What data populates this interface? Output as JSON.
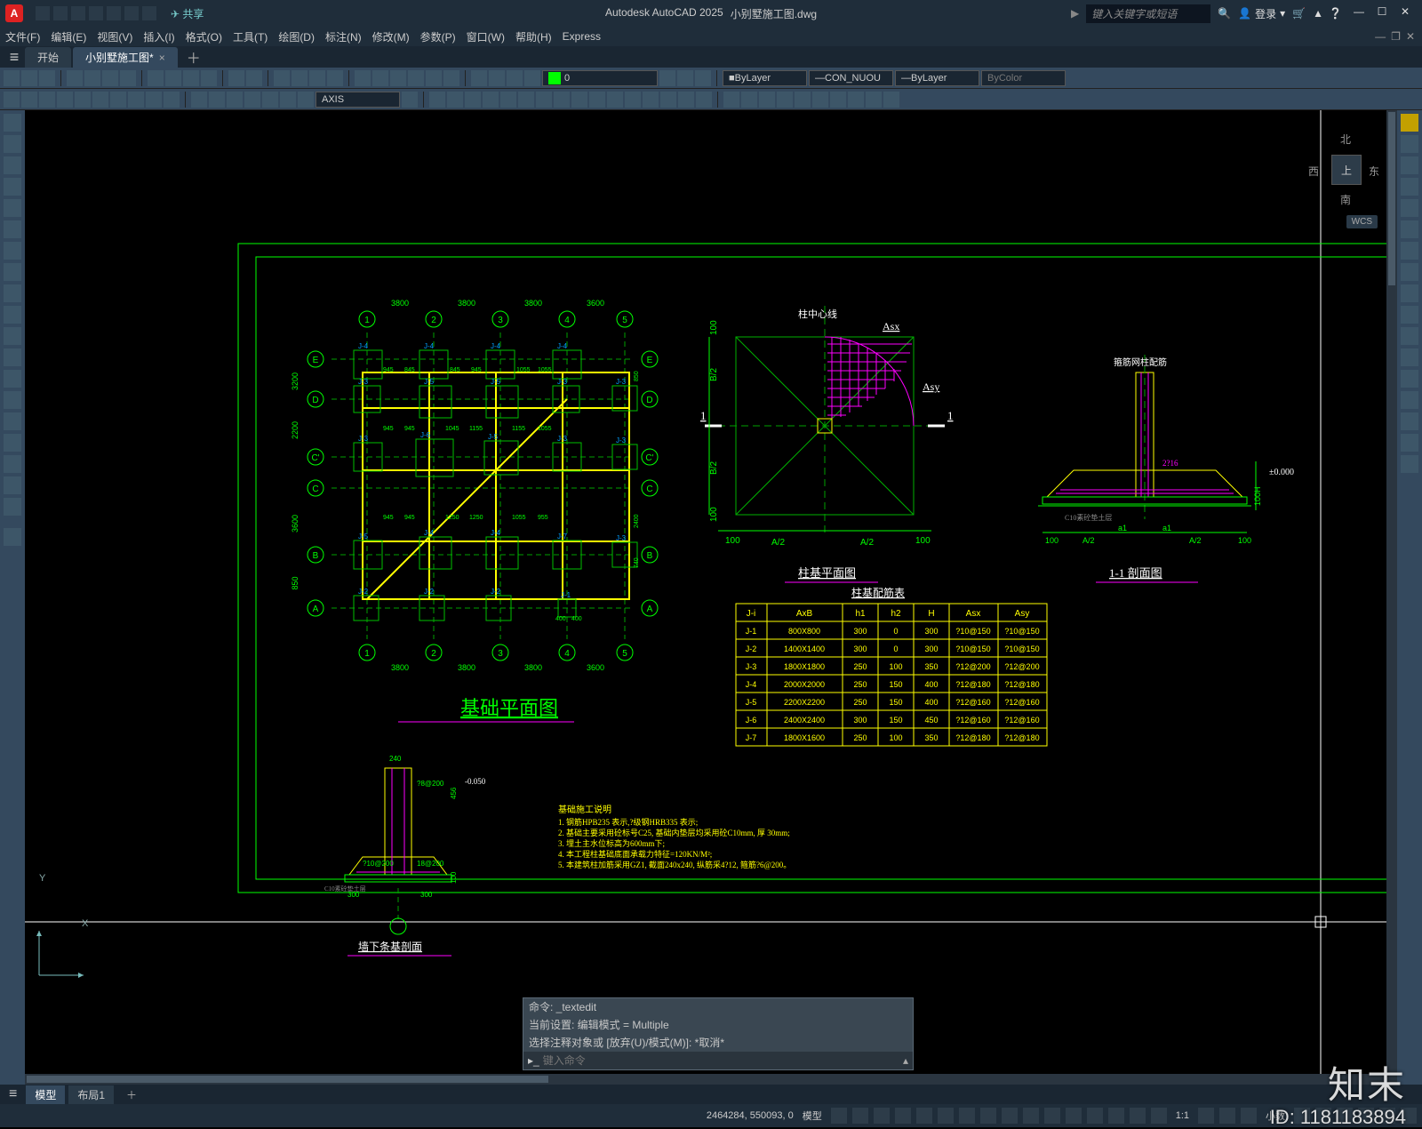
{
  "app": {
    "name": "Autodesk AutoCAD 2025",
    "doc": "小别墅施工图.dwg",
    "icon": "A"
  },
  "qat": {
    "share": "共享"
  },
  "search_placeholder": "键入关键字或短语",
  "login_label": "登录",
  "menu": [
    "文件(F)",
    "编辑(E)",
    "视图(V)",
    "插入(I)",
    "格式(O)",
    "工具(T)",
    "绘图(D)",
    "标注(N)",
    "修改(M)",
    "参数(P)",
    "窗口(W)",
    "帮助(H)",
    "Express"
  ],
  "tabs": {
    "start": "开始",
    "active": "小别墅施工图*"
  },
  "combos": {
    "layer_name": "0",
    "layer_prop": "ByLayer",
    "linetype": "CON_NUOU",
    "lineweight": "ByLayer",
    "plotstyle": "ByColor",
    "text_style": "AXIS"
  },
  "viewcube": {
    "n": "北",
    "s": "南",
    "e": "东",
    "w": "西",
    "face": "上",
    "wcs": "WCS"
  },
  "ucs": {
    "x": "X",
    "y": "Y"
  },
  "cmd": {
    "l1": "命令: _textedit",
    "l2": "当前设置: 编辑模式 = Multiple",
    "l3": "选择注释对象或 [放弃(U)/模式(M)]: *取消*",
    "prompt": "键入命令"
  },
  "modeltabs": {
    "model": "模型",
    "layout1": "布局1"
  },
  "status": {
    "coords": "2464284, 550093, 0",
    "modelspace": "模型",
    "grid": "",
    "scale": "1:1",
    "annoicon": "",
    "dec": "小数",
    "gear": ""
  },
  "drawing": {
    "plan_title": "基础平面图",
    "col_plan_title": "柱基平面图",
    "section_title": "1-1 剖面图",
    "col_centerline": "柱中心线",
    "strip_section_title": "墙下条基剖面",
    "spec_table_title": "柱基配筋表",
    "rebar_near_col": "箍筋网柱配筋",
    "table": {
      "headers": [
        "J-i",
        "AxB",
        "h1",
        "h2",
        "H",
        "Asx",
        "Asy"
      ],
      "rows": [
        [
          "J-1",
          "800X800",
          "300",
          "0",
          "300",
          "?10@150",
          "?10@150"
        ],
        [
          "J-2",
          "1400X1400",
          "300",
          "0",
          "300",
          "?10@150",
          "?10@150"
        ],
        [
          "J-3",
          "1800X1800",
          "250",
          "100",
          "350",
          "?12@200",
          "?12@200"
        ],
        [
          "J-4",
          "2000X2000",
          "250",
          "150",
          "400",
          "?12@180",
          "?12@180"
        ],
        [
          "J-5",
          "2200X2200",
          "250",
          "150",
          "400",
          "?12@160",
          "?12@160"
        ],
        [
          "J-6",
          "2400X2400",
          "300",
          "150",
          "450",
          "?12@160",
          "?12@160"
        ],
        [
          "J-7",
          "1800X1600",
          "250",
          "100",
          "350",
          "?12@180",
          "?12@180"
        ]
      ]
    },
    "plan_grid_dims": [
      "3800",
      "3800",
      "3800",
      "3600"
    ],
    "plan_grid_dims_v": [
      "3200",
      "2200",
      "3600",
      "850"
    ],
    "plan_bubbles": [
      "1",
      "2",
      "3",
      "4",
      "5"
    ],
    "plan_bubbles_v": [
      "E",
      "D",
      "C'",
      "C",
      "B",
      "A"
    ],
    "plan_labels": [
      "J-4",
      "J-4",
      "J-4",
      "J-4",
      "J-5",
      "J-3",
      "J-3",
      "J-6",
      "J-3",
      "J-5",
      "J-4",
      "J-2",
      "J-7",
      "J-3",
      "J-1"
    ],
    "plan_internal": [
      "945",
      "845",
      "845",
      "945",
      "945",
      "945",
      "945",
      "945",
      "1055",
      "1055",
      "1055",
      "1155",
      "1155",
      "1250",
      "400",
      "740",
      "2400",
      "850"
    ],
    "col_plan": {
      "asx": "Asx",
      "asy": "Asy",
      "a2": "A/2",
      "b2": "B/2",
      "d100": "100",
      "one": "1"
    },
    "section": {
      "a2": "A/2",
      "a1": "a1",
      "d100": "100",
      "el": "±0.000",
      "h": "H",
      "note": "C10素砼垫土层",
      "rebar": "2?16"
    },
    "strip": {
      "w": "240",
      "h": "300",
      "d": "200",
      "note": "C10素砼垫土层",
      "rebar": "?10@200",
      "el": "-0.050",
      "mark": "?8@200",
      "val2": "456",
      "val3": "100"
    },
    "notes_title": "基础施工说明",
    "notes": [
      "1. 钢筋HPB235 表示,?级钢HRB335 表示;",
      "2. 基础主要采用砼标号C25, 基础内垫层均采用砼C10mm, 厚 30mm;",
      "3. 埋土主水位标高为600mm下;",
      "4. 本工程柱基础底面承载力特征=120KN/M²;",
      "5. 本建筑柱加筋采用GZ1, 截面240x240, 纵筋采4?12, 箍筋?6@200。"
    ]
  },
  "brand": "知末",
  "brand_id": "ID: 1181183894"
}
